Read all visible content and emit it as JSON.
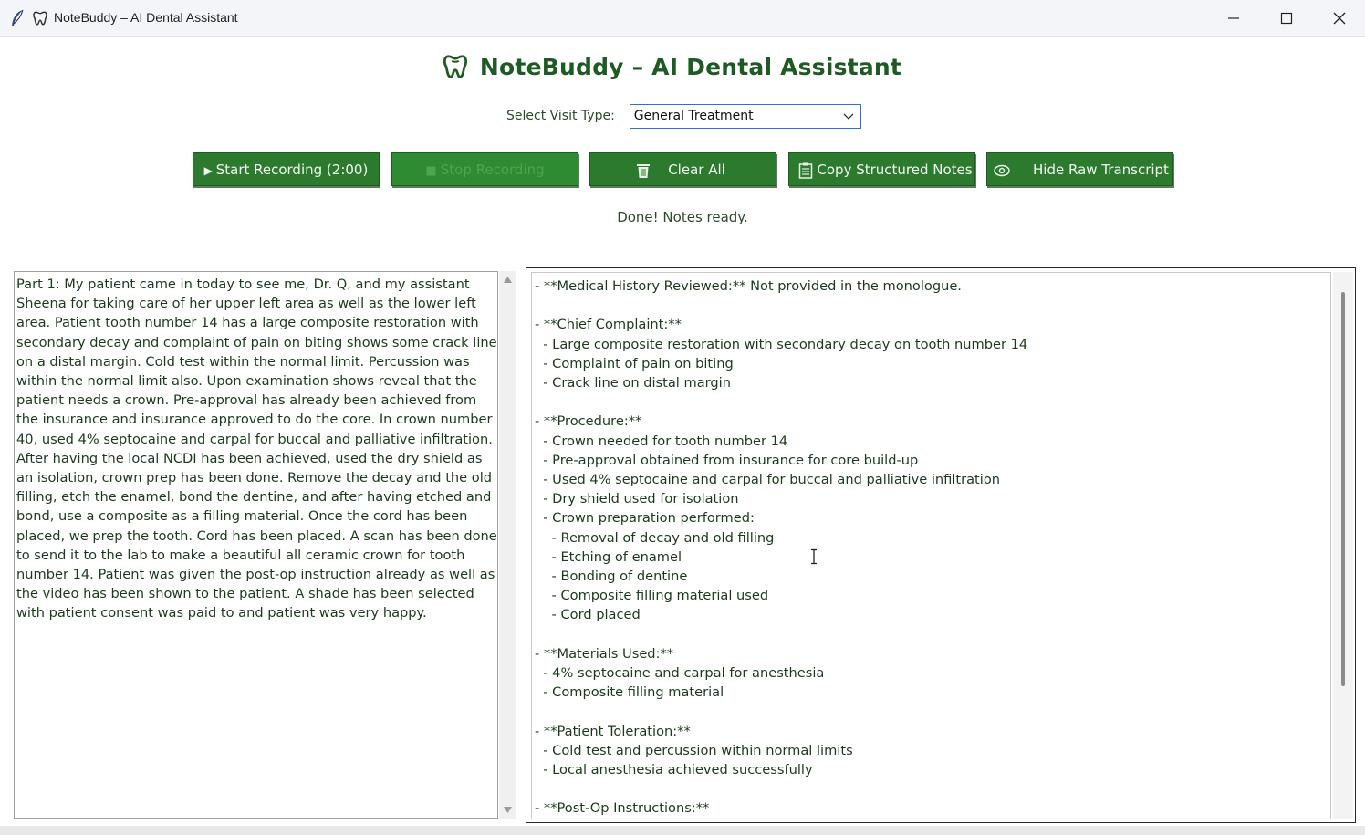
{
  "window": {
    "title": "NoteBuddy – AI Dental Assistant",
    "icons": [
      "feather-icon",
      "tooth-icon"
    ],
    "controls": [
      "minimize-icon",
      "maximize-icon",
      "close-icon"
    ]
  },
  "header": {
    "title": "NoteBuddy – AI Dental Assistant",
    "icon": "tooth-icon",
    "title_color": "#1e5a23"
  },
  "visit": {
    "label": "Select Visit Type:",
    "selected": "General Treatment"
  },
  "buttons": {
    "start_recording": "Start Recording (2:00)",
    "stop_recording": "Stop Recording",
    "clear_all": "Clear All",
    "copy_notes": "Copy Structured Notes",
    "hide_raw": "Hide Raw Transcript"
  },
  "colors": {
    "button_green": "#2b7a2d",
    "select_border": "#2f6fd6"
  },
  "status": "Done! Notes ready.",
  "raw_transcript": "Part 1: My patient came in today to see me, Dr. Q, and my assistant Sheena for taking care of her upper left area as well as the lower left area. Patient tooth number 14 has a large composite restoration with secondary decay and complaint of pain on biting shows some crack line on a distal margin. Cold test within the normal limit. Percussion was within the normal limit also. Upon examination shows reveal that the patient needs a crown. Pre-approval has already been achieved from the insurance and insurance approved to do the core. In crown number 40, used 4% septocaine and carpal for buccal and palliative infiltration. After having the local NCDI has been achieved, used the dry shield as an isolation, crown prep has been done. Remove the decay and the old filling, etch the enamel, bond the dentine, and after having etched and bond, use a composite as a filling material. Once the cord has been placed, we prep the tooth. Cord has been placed. A scan has been done to send it to the lab to make a beautiful all ceramic crown for tooth number 14. Patient was given the post-op instruction already as well as the video has been shown to the patient. A shade has been selected with patient consent was paid to and patient was very happy.",
  "structured_notes": [
    "- **Medical History Reviewed:** Not provided in the monologue.",
    "",
    "- **Chief Complaint:**",
    "  - Large composite restoration with secondary decay on tooth number 14",
    "  - Complaint of pain on biting",
    "  - Crack line on distal margin",
    "",
    "- **Procedure:**",
    "  - Crown needed for tooth number 14",
    "  - Pre-approval obtained from insurance for core build-up",
    "  - Used 4% septocaine and carpal for buccal and palliative infiltration",
    "  - Dry shield used for isolation",
    "  - Crown preparation performed:",
    "    - Removal of decay and old filling",
    "    - Etching of enamel",
    "    - Bonding of dentine",
    "    - Composite filling material used",
    "    - Cord placed",
    "",
    "- **Materials Used:**",
    "  - 4% septocaine and carpal for anesthesia",
    "  - Composite filling material",
    "",
    "- **Patient Toleration:**",
    "  - Cold test and percussion within normal limits",
    "  - Local anesthesia achieved successfully",
    "",
    "- **Post-Op Instructions:**"
  ]
}
